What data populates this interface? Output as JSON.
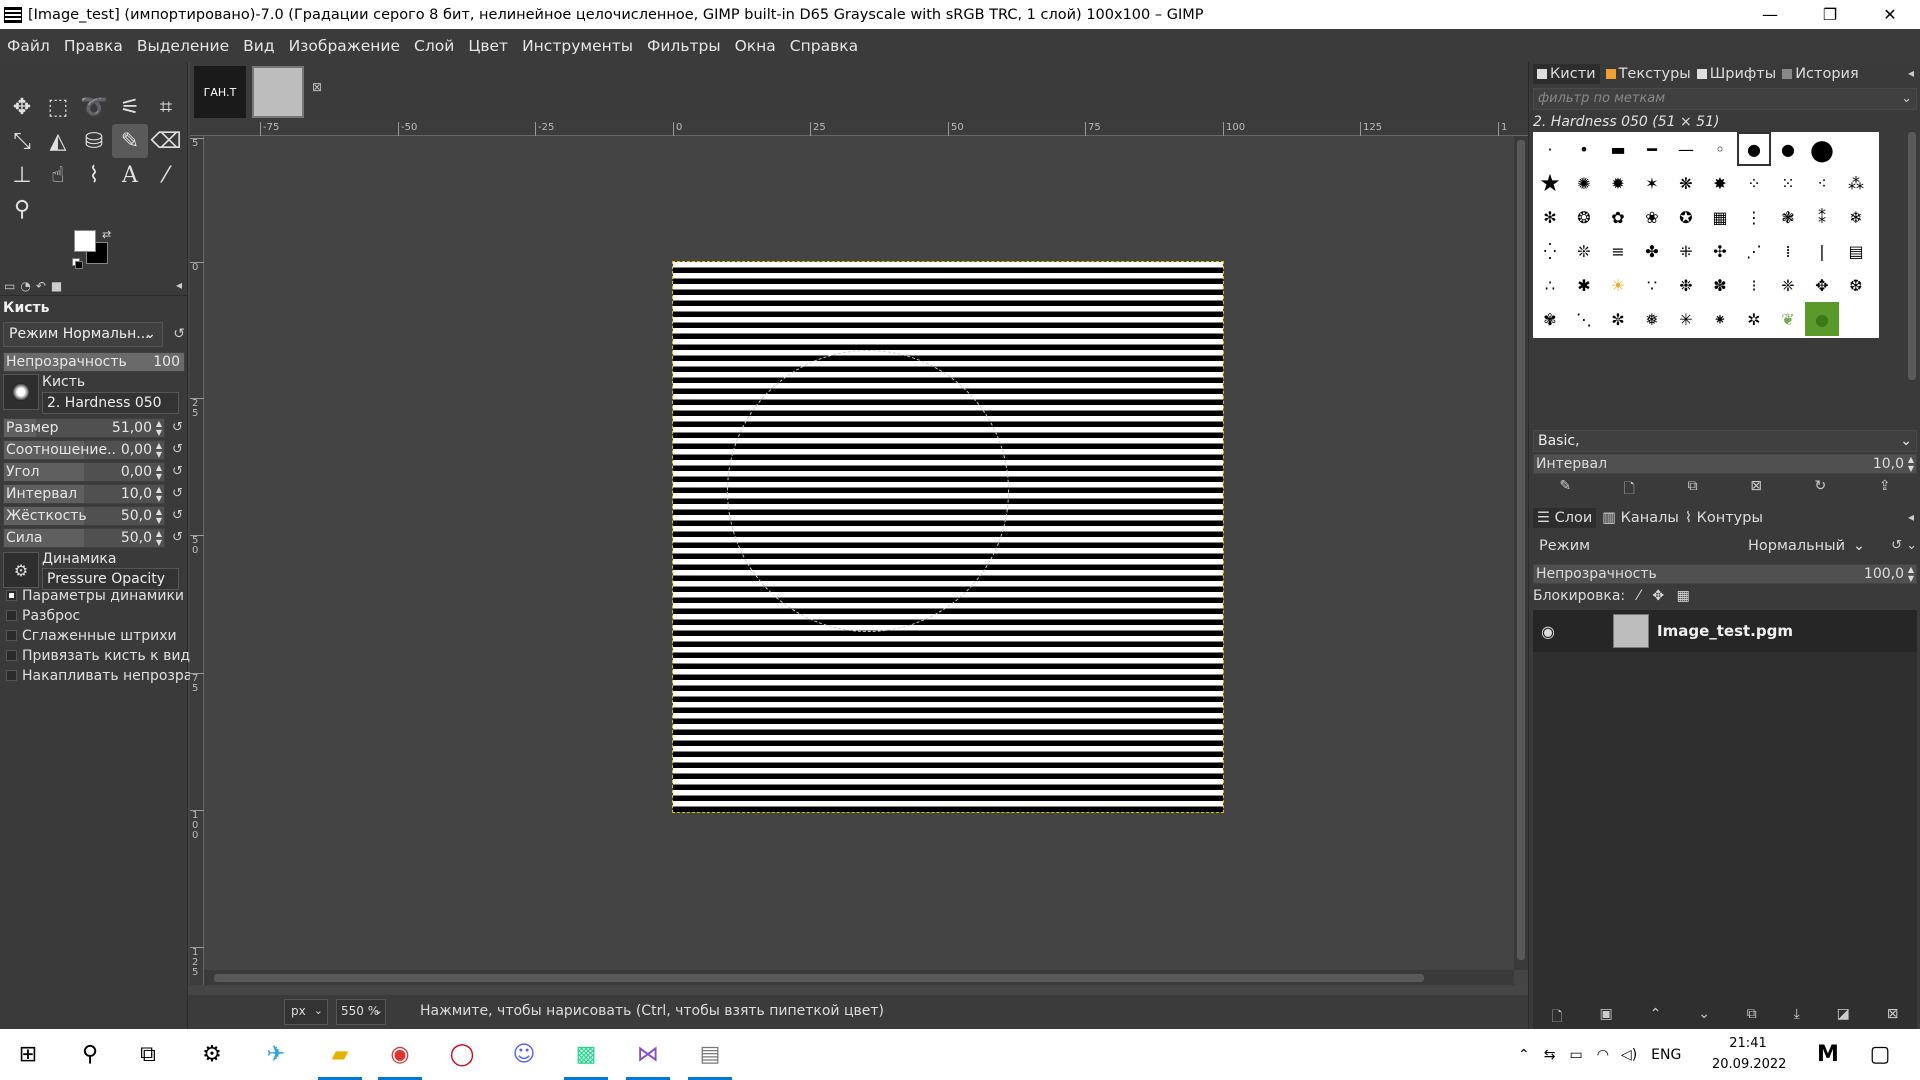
{
  "window": {
    "title": "[Image_test] (импортировано)-7.0 (Градации серого 8 бит, нелинейное целочисленное, GIMP built-in D65 Grayscale with sRGB TRC, 1 слой) 100x100 – GIMP",
    "minimize": "—",
    "maximize": "❐",
    "close": "✕"
  },
  "menu": [
    "Файл",
    "Правка",
    "Выделение",
    "Вид",
    "Изображение",
    "Слой",
    "Цвет",
    "Инструменты",
    "Фильтры",
    "Окна",
    "Справка"
  ],
  "tool_options": {
    "title": "Кисть",
    "mode": "Режим Нормальн...",
    "opacity_label": "Непрозрачность",
    "opacity_value": "100",
    "brush_label": "Кисть",
    "brush_name": "2. Hardness 050",
    "size_label": "Размер",
    "size_value": "51,00",
    "ratio_label": "Соотношение...",
    "ratio_value": "0,00",
    "angle_label": "Угол",
    "angle_value": "0,00",
    "spacing_label": "Интервал",
    "spacing_value": "10,0",
    "hardness_label": "Жёсткость",
    "hardness_value": "50,0",
    "force_label": "Сила",
    "force_value": "50,0",
    "dynamics_label": "Динамика рисования",
    "dynamics_name": "Pressure Opacity",
    "options": [
      {
        "label": "Параметры динамики",
        "checked": true
      },
      {
        "label": "Разброс",
        "checked": false
      },
      {
        "label": "Сглаженные штрихи",
        "checked": false
      },
      {
        "label": "Привязать кисть к виду",
        "checked": false
      },
      {
        "label": "Накапливать непрозрачн",
        "checked": false
      }
    ]
  },
  "image_tabs": {
    "thumb1_text": "ГАН.Т",
    "close": "⊠"
  },
  "ruler": {
    "top": [
      "-75",
      "-50",
      "-25",
      "0",
      "25",
      "50",
      "75",
      "100",
      "125",
      "1"
    ],
    "left": [
      "5",
      "0",
      "2 5",
      "5 0",
      "7 5",
      "1 0 0",
      "1 2 5"
    ]
  },
  "status": {
    "unit": "px",
    "zoom": "550 %",
    "message": "Нажмите, чтобы нарисовать (Ctrl, чтобы взять пипеткой цвет)"
  },
  "brushes_dock": {
    "tabs": [
      "Кисти",
      "Текстуры",
      "Шрифты",
      "История"
    ],
    "filter_placeholder": "фильтр по меткам",
    "selected_brush": "2. Hardness 050 (51 × 51)",
    "tag": "Basic,",
    "interval_label": "Интервал",
    "interval_value": "10,0"
  },
  "layers_dock": {
    "tabs": [
      "Слои",
      "Каналы",
      "Контуры"
    ],
    "mode_label": "Режим",
    "mode_value": "Нормальный",
    "opacity_label": "Непрозрачность",
    "opacity_value": "100,0",
    "lock_label": "Блокировка:",
    "layer_name": "Image_test.pgm"
  },
  "taskbar": {
    "lang": "ENG",
    "time": "21:41",
    "date": "20.09.2022"
  },
  "colors": {
    "accent": "#0078d4",
    "selection": "#d8c200"
  }
}
